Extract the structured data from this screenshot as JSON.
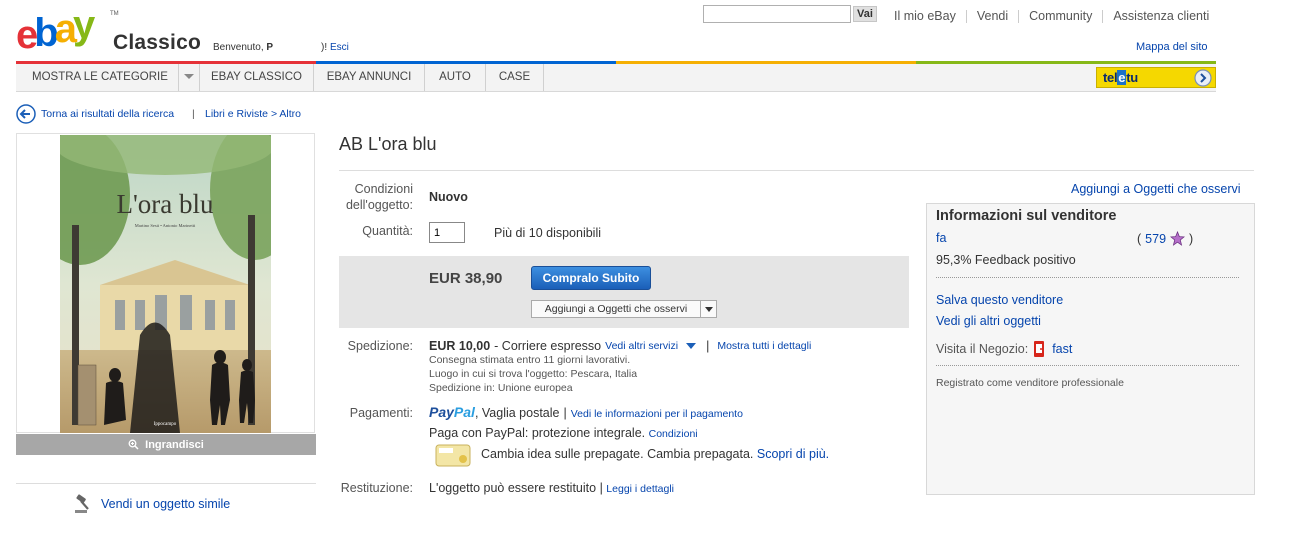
{
  "header": {
    "logo_text": "ebay",
    "logo_colors": [
      "#e53238",
      "#0064d2",
      "#f5af02",
      "#86b817"
    ],
    "logo_tm": "TM",
    "brand_suffix": "Classico",
    "welcome_prefix": "Benvenuto, ",
    "welcome_user": "P",
    "welcome_suffix": ")!",
    "logout_label": "Esci",
    "search": {
      "value": "",
      "button_label": "Vai"
    },
    "top_links": [
      "Il mio eBay",
      "Vendi",
      "Community",
      "Assistenza clienti"
    ],
    "site_map_label": "Mappa del sito"
  },
  "nav": {
    "categories_label": "MOSTRA LE CATEGORIE",
    "items": [
      "EBAY CLASSICO",
      "EBAY ANNUNCI",
      "AUTO",
      "CASE"
    ],
    "ad": {
      "pre": "tel",
      "mid": "e",
      "post": "tu"
    }
  },
  "breadcrumb": {
    "back_label": "Torna ai risultati della ricerca",
    "separator": "|",
    "path": "Libri e Riviste > Altro"
  },
  "image": {
    "cover_title": "L'ora blu",
    "cover_authors": "Martino Sesti • Antonio Marinetti",
    "cover_publisher": "Ippocampo",
    "zoom_label": "Ingrandisci"
  },
  "sell_similar_label": "Vendi un oggetto simile",
  "item": {
    "title": "AB L'ora blu",
    "condition_label": "Condizioni\ndell'oggetto:",
    "condition_value": "Nuovo",
    "quantity_label": "Quantità:",
    "quantity_value": "1",
    "availability": "Più di 10 disponibili",
    "price": "EUR 38,90",
    "buy_now_label": "Compralo Subito",
    "watch_button_label": "Aggiungi a Oggetti che osservi"
  },
  "shipping": {
    "label": "Spedizione:",
    "cost": "EUR 10,00",
    "method": " - Corriere espresso",
    "more_services": "Vedi altri servizi",
    "separator": "|",
    "show_details": "Mostra tutti i dettagli",
    "delivery": "Consegna stimata entro 11 giorni lavorativi.",
    "location": "Luogo in cui si trova l'oggetto: Pescara, Italia",
    "ships_to": "Spedizione in: Unione europea"
  },
  "payments": {
    "label": "Pagamenti:",
    "paypal_pre": "Pay",
    "paypal_post": "Pal",
    "methods": ", Vaglia postale",
    "separator": "|",
    "payment_info_link": "Vedi le informazioni per il pagamento",
    "protection_text": "Paga con PayPal: protezione integrale.",
    "conditions_link": "Condizioni",
    "prepaid_text": "Cambia idea sulle prepagate. Cambia prepagata.",
    "learn_more_link": "Scopri di più."
  },
  "returns": {
    "label": "Restituzione:",
    "text": "L'oggetto può essere restituito",
    "separator": "|",
    "details_link": "Leggi i dettagli"
  },
  "seller": {
    "watch_link": "Aggiungi a Oggetti che osservi",
    "title": "Informazioni sul venditore",
    "name": "fa",
    "feedback_open": "(",
    "feedback_score": "579",
    "feedback_close": ")",
    "feedback_percent": "95,3% Feedback positivo",
    "save_seller": "Salva questo venditore",
    "other_items": "Vedi gli altri oggetti",
    "store_label": "Visita il Negozio:",
    "store_name": "fast",
    "registration": "Registrato come venditore professionale"
  }
}
